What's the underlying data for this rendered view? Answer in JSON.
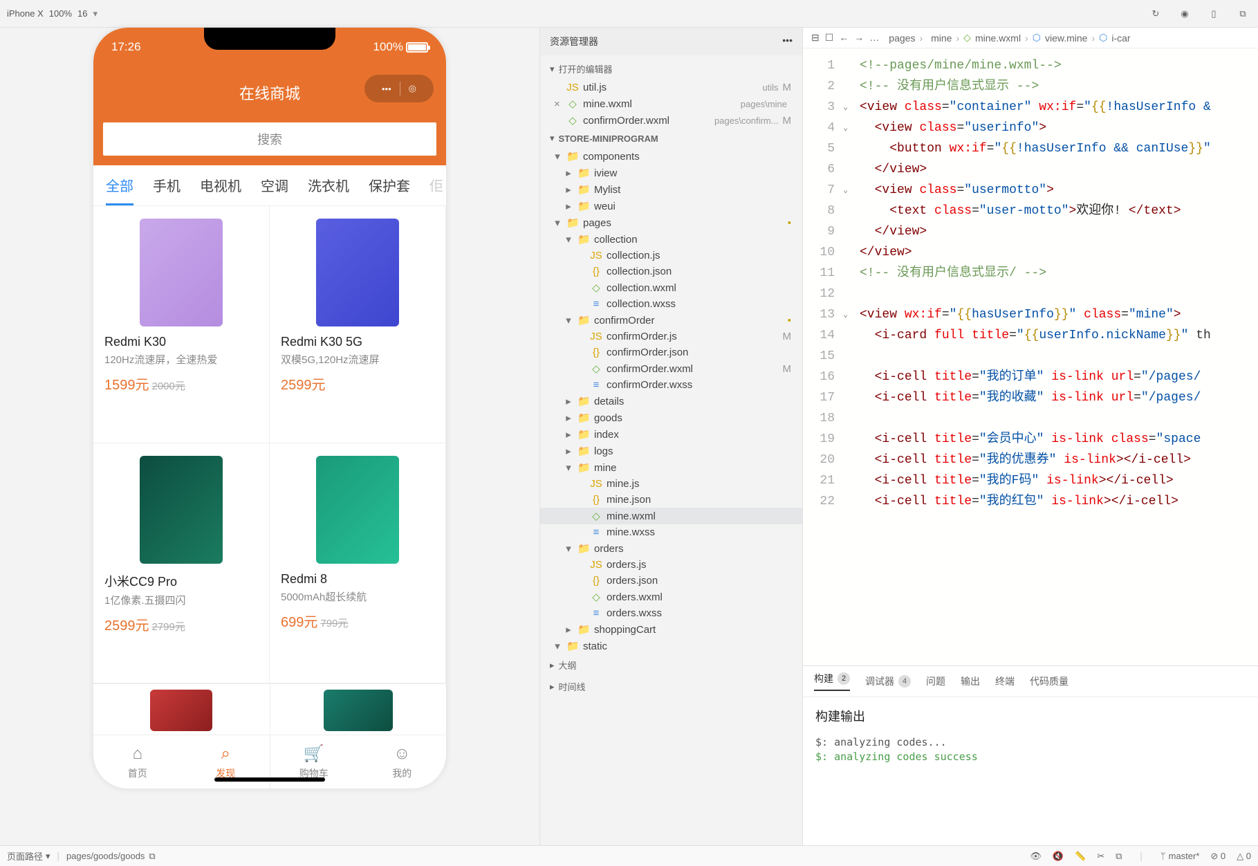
{
  "toolbar": {
    "device": "iPhone X",
    "zoom": "100%",
    "font": "16"
  },
  "phone": {
    "time": "17:26",
    "battery": "100%",
    "title": "在线商城",
    "search_placeholder": "搜索",
    "tabs": [
      "全部",
      "手机",
      "电视机",
      "空调",
      "洗衣机",
      "保护套"
    ],
    "products": [
      {
        "name": "Redmi K30",
        "desc": "120Hz流速屏，全速热爱",
        "price": "1599元",
        "old": "2000元",
        "color": "linear-gradient(135deg,#c9a8ea,#b58de0)"
      },
      {
        "name": "Redmi K30 5G",
        "desc": "双模5G,120Hz流速屏",
        "price": "2599元",
        "old": "",
        "color": "linear-gradient(135deg,#5a5fe0,#3e46d0)"
      },
      {
        "name": "小米CC9 Pro",
        "desc": "1亿像素.五摄四闪",
        "price": "2599元",
        "old": "2799元",
        "color": "linear-gradient(135deg,#0d4d40,#1a7c5f)"
      },
      {
        "name": "Redmi 8",
        "desc": "5000mAh超长续航",
        "price": "699元",
        "old": "799元",
        "color": "linear-gradient(135deg,#1a9a7a,#26c096)"
      }
    ],
    "tabbar": [
      {
        "label": "首页",
        "icon": "⌂"
      },
      {
        "label": "发现",
        "icon": "⌕"
      },
      {
        "label": "购物车",
        "icon": "🛒"
      },
      {
        "label": "我的",
        "icon": "☺"
      }
    ]
  },
  "explorer": {
    "title": "资源管理器",
    "open_editors": "打开的编辑器",
    "files_open": [
      {
        "name": "util.js",
        "hint": "utils",
        "type": "js",
        "m": "M",
        "close": ""
      },
      {
        "name": "mine.wxml",
        "hint": "pages\\mine",
        "type": "wxml",
        "m": "",
        "close": "×"
      },
      {
        "name": "confirmOrder.wxml",
        "hint": "pages\\confirm...",
        "type": "wxml",
        "m": "M",
        "close": ""
      }
    ],
    "project": "STORE-MINIPROGRAM",
    "tree": [
      {
        "name": "components",
        "ind": 18,
        "chev": "▾",
        "type": "fld-c"
      },
      {
        "name": "iview",
        "ind": 34,
        "chev": "▸",
        "type": "fld"
      },
      {
        "name": "Mylist",
        "ind": 34,
        "chev": "▸",
        "type": "fld"
      },
      {
        "name": "weui",
        "ind": 34,
        "chev": "▸",
        "type": "fld"
      },
      {
        "name": "pages",
        "ind": 18,
        "chev": "▾",
        "type": "fld-p",
        "dot": "•"
      },
      {
        "name": "collection",
        "ind": 34,
        "chev": "▾",
        "type": "fld"
      },
      {
        "name": "collection.js",
        "ind": 52,
        "chev": "",
        "type": "js"
      },
      {
        "name": "collection.json",
        "ind": 52,
        "chev": "",
        "type": "json"
      },
      {
        "name": "collection.wxml",
        "ind": 52,
        "chev": "",
        "type": "wxml"
      },
      {
        "name": "collection.wxss",
        "ind": 52,
        "chev": "",
        "type": "wxss"
      },
      {
        "name": "confirmOrder",
        "ind": 34,
        "chev": "▾",
        "type": "fld",
        "dot": "•"
      },
      {
        "name": "confirmOrder.js",
        "ind": 52,
        "chev": "",
        "type": "js",
        "m": "M"
      },
      {
        "name": "confirmOrder.json",
        "ind": 52,
        "chev": "",
        "type": "json"
      },
      {
        "name": "confirmOrder.wxml",
        "ind": 52,
        "chev": "",
        "type": "wxml",
        "m": "M"
      },
      {
        "name": "confirmOrder.wxss",
        "ind": 52,
        "chev": "",
        "type": "wxss"
      },
      {
        "name": "details",
        "ind": 34,
        "chev": "▸",
        "type": "fld"
      },
      {
        "name": "goods",
        "ind": 34,
        "chev": "▸",
        "type": "fld"
      },
      {
        "name": "index",
        "ind": 34,
        "chev": "▸",
        "type": "fld"
      },
      {
        "name": "logs",
        "ind": 34,
        "chev": "▸",
        "type": "fld"
      },
      {
        "name": "mine",
        "ind": 34,
        "chev": "▾",
        "type": "fld"
      },
      {
        "name": "mine.js",
        "ind": 52,
        "chev": "",
        "type": "js"
      },
      {
        "name": "mine.json",
        "ind": 52,
        "chev": "",
        "type": "json"
      },
      {
        "name": "mine.wxml",
        "ind": 52,
        "chev": "",
        "type": "wxml",
        "sel": true
      },
      {
        "name": "mine.wxss",
        "ind": 52,
        "chev": "",
        "type": "wxss"
      },
      {
        "name": "orders",
        "ind": 34,
        "chev": "▾",
        "type": "fld"
      },
      {
        "name": "orders.js",
        "ind": 52,
        "chev": "",
        "type": "js"
      },
      {
        "name": "orders.json",
        "ind": 52,
        "chev": "",
        "type": "json"
      },
      {
        "name": "orders.wxml",
        "ind": 52,
        "chev": "",
        "type": "wxml"
      },
      {
        "name": "orders.wxss",
        "ind": 52,
        "chev": "",
        "type": "wxss"
      },
      {
        "name": "shoppingCart",
        "ind": 34,
        "chev": "▸",
        "type": "fld"
      },
      {
        "name": "static",
        "ind": 18,
        "chev": "▾",
        "type": "fld-s"
      }
    ],
    "outline": "大纲",
    "timeline": "时间线"
  },
  "editor": {
    "tabs": [
      {
        "name": "util.js",
        "type": "js",
        "active": false
      },
      {
        "name": "mine.wxml",
        "type": "wxml",
        "active": true,
        "close": "×"
      },
      {
        "name": "confirmOrder.wxml",
        "type": "wxml",
        "active": false
      }
    ],
    "breadcrumb": [
      "pages",
      "mine",
      "mine.wxml",
      "view.mine",
      "i-car"
    ],
    "lines": [
      {
        "n": 1,
        "html": "<span class='c-cmt'>&lt;!--pages/mine/mine.wxml--&gt;</span>"
      },
      {
        "n": 2,
        "html": "<span class='c-cmt'>&lt;!-- 没有用户信息式显示 --&gt;</span>"
      },
      {
        "n": 3,
        "fold": "⌄",
        "html": "<span class='c-tag'>&lt;view</span> <span class='c-attr'>class</span>=<span class='c-str'>\"container\"</span> <span class='c-attr'>wx:if</span>=<span class='c-str'>\"</span><span class='c-bind'>{{</span><span class='c-str'>!hasUserInfo &</span>"
      },
      {
        "n": 4,
        "fold": "⌄",
        "html": "  <span class='c-tag'>&lt;view</span> <span class='c-attr'>class</span>=<span class='c-str'>\"userinfo\"</span><span class='c-tag'>&gt;</span>"
      },
      {
        "n": 5,
        "html": "    <span class='c-tag'>&lt;button</span> <span class='c-attr'>wx:if</span>=<span class='c-str'>\"</span><span class='c-bind'>{{</span><span class='c-str'>!hasUserInfo && canIUse</span><span class='c-bind'>}}</span><span class='c-str'>\"</span>"
      },
      {
        "n": 6,
        "html": "  <span class='c-tag'>&lt;/view&gt;</span>"
      },
      {
        "n": 7,
        "fold": "⌄",
        "html": "  <span class='c-tag'>&lt;view</span> <span class='c-attr'>class</span>=<span class='c-str'>\"usermotto\"</span><span class='c-tag'>&gt;</span>"
      },
      {
        "n": 8,
        "html": "    <span class='c-tag'>&lt;text</span> <span class='c-attr'>class</span>=<span class='c-str'>\"user-motto\"</span><span class='c-tag'>&gt;</span><span class='c-txt'>欢迎你! </span><span class='c-tag'>&lt;/text&gt;</span>"
      },
      {
        "n": 9,
        "html": "  <span class='c-tag'>&lt;/view&gt;</span>"
      },
      {
        "n": 10,
        "html": "<span class='c-tag'>&lt;/view&gt;</span>"
      },
      {
        "n": 11,
        "html": "<span class='c-cmt'>&lt;!-- 没有用户信息式显示/ --&gt;</span>"
      },
      {
        "n": 12,
        "html": ""
      },
      {
        "n": 13,
        "fold": "⌄",
        "html": "<span class='c-tag'>&lt;view</span> <span class='c-attr'>wx:if</span>=<span class='c-str'>\"</span><span class='c-bind'>{{</span><span class='c-str'>hasUserInfo</span><span class='c-bind'>}}</span><span class='c-str'>\"</span> <span class='c-attr'>class</span>=<span class='c-str'>\"mine\"</span><span class='c-tag'>&gt;</span>"
      },
      {
        "n": 14,
        "html": "  <span class='c-tag'>&lt;i-card</span> <span class='c-attr'>full</span> <span class='c-attr'>title</span>=<span class='c-str'>\"</span><span class='c-bind'>{{</span><span class='c-str'>userInfo.nickName</span><span class='c-bind'>}}</span><span class='c-str'>\"</span> th"
      },
      {
        "n": 15,
        "html": ""
      },
      {
        "n": 16,
        "html": "  <span class='c-tag'>&lt;i-cell</span> <span class='c-attr'>title</span>=<span class='c-str'>\"我的订单\"</span> <span class='c-attr'>is-link</span> <span class='c-attr'>url</span>=<span class='c-str'>\"/pages/</span>"
      },
      {
        "n": 17,
        "html": "  <span class='c-tag'>&lt;i-cell</span> <span class='c-attr'>title</span>=<span class='c-str'>\"我的收藏\"</span> <span class='c-attr'>is-link</span> <span class='c-attr'>url</span>=<span class='c-str'>\"/pages/</span>"
      },
      {
        "n": 18,
        "html": ""
      },
      {
        "n": 19,
        "html": "  <span class='c-tag'>&lt;i-cell</span> <span class='c-attr'>title</span>=<span class='c-str'>\"会员中心\"</span> <span class='c-attr'>is-link</span> <span class='c-attr'>class</span>=<span class='c-str'>\"space</span>"
      },
      {
        "n": 20,
        "html": "  <span class='c-tag'>&lt;i-cell</span> <span class='c-attr'>title</span>=<span class='c-str'>\"我的优惠券\"</span> <span class='c-attr'>is-link</span><span class='c-tag'>&gt;&lt;/i-cell&gt;</span>"
      },
      {
        "n": 21,
        "html": "  <span class='c-tag'>&lt;i-cell</span> <span class='c-attr'>title</span>=<span class='c-str'>\"我的F码\"</span> <span class='c-attr'>is-link</span><span class='c-tag'>&gt;&lt;/i-cell&gt;</span>"
      },
      {
        "n": 22,
        "html": "  <span class='c-tag'>&lt;i-cell</span> <span class='c-attr'>title</span>=<span class='c-str'>\"我的红包\"</span> <span class='c-attr'>is-link</span><span class='c-tag'>&gt;&lt;/i-cell&gt;</span>"
      }
    ]
  },
  "output": {
    "tabs": [
      {
        "label": "构建",
        "badge": "2",
        "active": true
      },
      {
        "label": "调试器",
        "badge": "4"
      },
      {
        "label": "问题"
      },
      {
        "label": "输出"
      },
      {
        "label": "终端"
      },
      {
        "label": "代码质量"
      }
    ],
    "heading": "构建输出",
    "lines": [
      {
        "text": "$: analyzing codes...",
        "ok": false
      },
      {
        "text": "$: analyzing codes success",
        "ok": true
      }
    ]
  },
  "footer": {
    "label": "页面路径",
    "path": "pages/goods/goods",
    "branch": "master*",
    "errors": "⊘ 0",
    "warnings": "△ 0"
  }
}
